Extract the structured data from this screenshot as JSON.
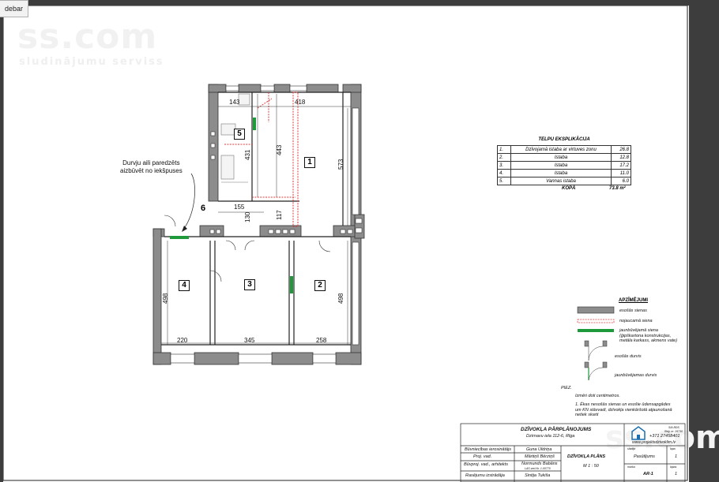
{
  "tab": {
    "label": "debar"
  },
  "watermark": {
    "logo": "ss.com",
    "subtitle": "sludinājumu serviss",
    "corner": "ss.com"
  },
  "plan": {
    "note": "Durvju aili paredzēts\naizbūvēt no iekšpuses",
    "rooms": {
      "r1": "1",
      "r2": "2",
      "r3": "3",
      "r4": "4",
      "r5": "5",
      "r6": "6"
    },
    "dims": {
      "d143": "143",
      "d418": "418",
      "d443": "443",
      "d431": "431",
      "d573": "573",
      "d155": "155",
      "d130": "130",
      "d117": "117",
      "d498a": "498",
      "d498b": "498",
      "d220": "220",
      "d345": "345",
      "d258": "258"
    }
  },
  "schedule": {
    "title": "TELPU EKSPLIKĀCIJA",
    "rows": [
      {
        "n": "1.",
        "name": "Dzīvojamā istaba ar virtuves zonu",
        "area": "26.8"
      },
      {
        "n": "2.",
        "name": "Istaba",
        "area": "12.8"
      },
      {
        "n": "3.",
        "name": "Istaba",
        "area": "17.2"
      },
      {
        "n": "4.",
        "name": "Istaba",
        "area": "11.0"
      },
      {
        "n": "5.",
        "name": "Vannas istaba",
        "area": "6.0"
      }
    ],
    "total_label": "KOPĀ",
    "total_value": "73.8 m²"
  },
  "legend": {
    "title": "APZĪMĒJUMI",
    "items": {
      "existing_wall": "esošās sienas",
      "demolished_wall": "nojaucamā siena",
      "new_wall": "jaunbūvējamā siena\n(ģipškartona konstrukcijas,\nmetāla karkass, akmens vate)",
      "existing_doors": "esošās durvis",
      "new_doors": "jaunbūvējamas durvis"
    },
    "colors": {
      "existing": "#8c8c8c",
      "demolished": "#e03a3a",
      "new": "#1f9a3a"
    }
  },
  "notes": {
    "head": "PIEZ.",
    "line1": "Izmēri doti centimetros.",
    "line2": "1. Ēkas nesošās sienas un esošie ūdensapgādes\num KN stāvvadi, dzīvokļa vienkāršotā atjaunošanā\nnetiek skarti"
  },
  "titleblock": {
    "project": "DZĪVOKĻA PĀRPLĀNOJUMS",
    "address": "Dzirnavu iela 112-6, Rīga",
    "role1": "Būvniecības ierosinātājs",
    "role2": "Proj. vad.",
    "role3": "Būvproj. vad., arhitekts",
    "role4": "Rasējumu izstrādāja",
    "name1": "Guna Uldriņa",
    "name2": "Mārtiņš Bērziņš",
    "name3": "Normunds Babāns",
    "name3b": "LAS sert.Nr. 1-00770",
    "name4": "Sintija Tukiša",
    "sheet_title": "DZĪVOKĻA PLĀNS",
    "scale": "M 1 : 50",
    "stage_label": "stadija",
    "stage": "Pasūtījums",
    "lapa_label": "lapa",
    "lapa": "1",
    "code_label": "marka",
    "code": "AR-1",
    "lapas_label": "lapas",
    "lapas": "1",
    "firm_small1": "SIA BDS",
    "firm_small2": "Reģ. nr. 26730",
    "phone": "+371 27458401",
    "web": "www.projektsdzivoklim.lv"
  }
}
